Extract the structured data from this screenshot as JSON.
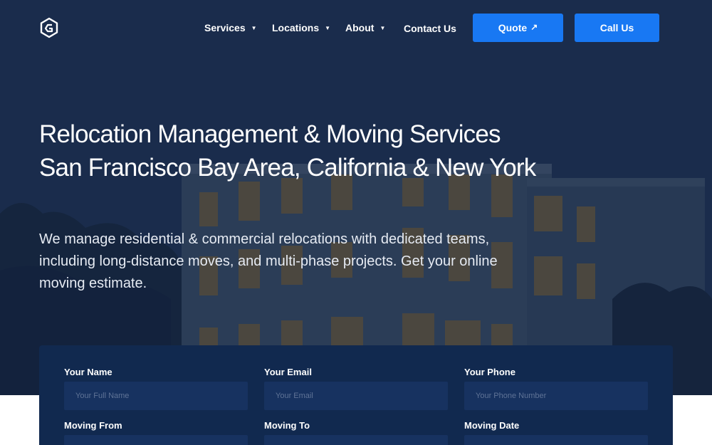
{
  "header": {
    "nav": [
      {
        "label": "Services",
        "has_dropdown": true
      },
      {
        "label": "Locations",
        "has_dropdown": true
      },
      {
        "label": "About",
        "has_dropdown": true
      },
      {
        "label": "Contact Us",
        "has_dropdown": false
      }
    ],
    "quote_label": "Quote",
    "call_label": "Call Us"
  },
  "hero": {
    "headline": "Relocation Management & Moving Services San Francisco Bay Area, California & New York",
    "subtext": "We manage residential & commercial relocations with dedicated teams, including long-distance moves, and multi-phase projects. Get your online moving estimate."
  },
  "form": {
    "name": {
      "label": "Your Name",
      "placeholder": "Your Full Name"
    },
    "email": {
      "label": "Your Email",
      "placeholder": "Your Email"
    },
    "phone": {
      "label": "Your Phone",
      "placeholder": "Your Phone Number"
    },
    "from": {
      "label": "Moving From"
    },
    "to": {
      "label": "Moving To"
    },
    "date": {
      "label": "Moving Date"
    }
  },
  "colors": {
    "accent": "#1878f3",
    "hero_bg": "#1e3150",
    "form_bg": "#11294f",
    "input_bg": "#173260"
  }
}
